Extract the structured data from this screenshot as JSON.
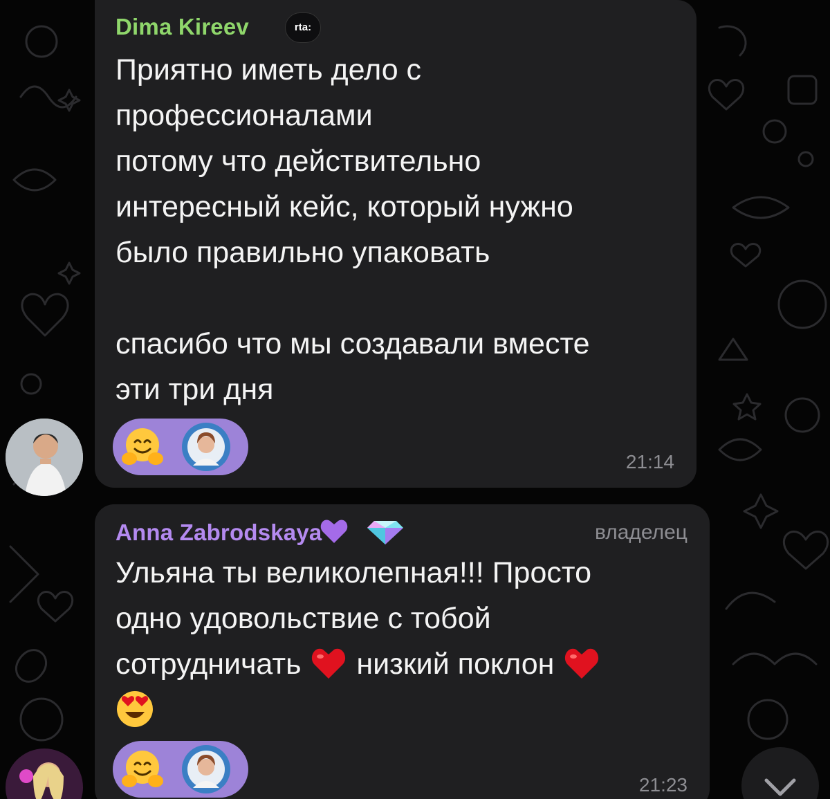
{
  "messages": [
    {
      "sender": "Dima Kireev",
      "badge": "rta:",
      "text": "Приятно иметь дело с\nпрофессионалами\nпотому что действительно\nинтересный кейс, который нужно\nбыло правильно упаковать\n\nспасибо что мы создавали вместе\nэти три дня",
      "reactions": [
        "hugging-face-emoji"
      ],
      "time": "21:14"
    },
    {
      "sender": "Anna Zabrodskaya",
      "sender_suffix_icons": [
        "purple-heart-icon",
        "gem-icon"
      ],
      "role": "владелец",
      "text_lines": [
        "Ульяна ты великолепная!!! Просто",
        "одно удовольствие с тобой",
        "сотрудничать",
        "низкий поклон"
      ],
      "reactions": [
        "hugging-face-emoji"
      ],
      "time": "21:23"
    }
  ],
  "colors": {
    "bubble": "#1f1f21",
    "sender_green": "#8fd66b",
    "sender_purple": "#b48af0",
    "reaction_pill": "#9d83d8",
    "time": "#8d8d92"
  }
}
